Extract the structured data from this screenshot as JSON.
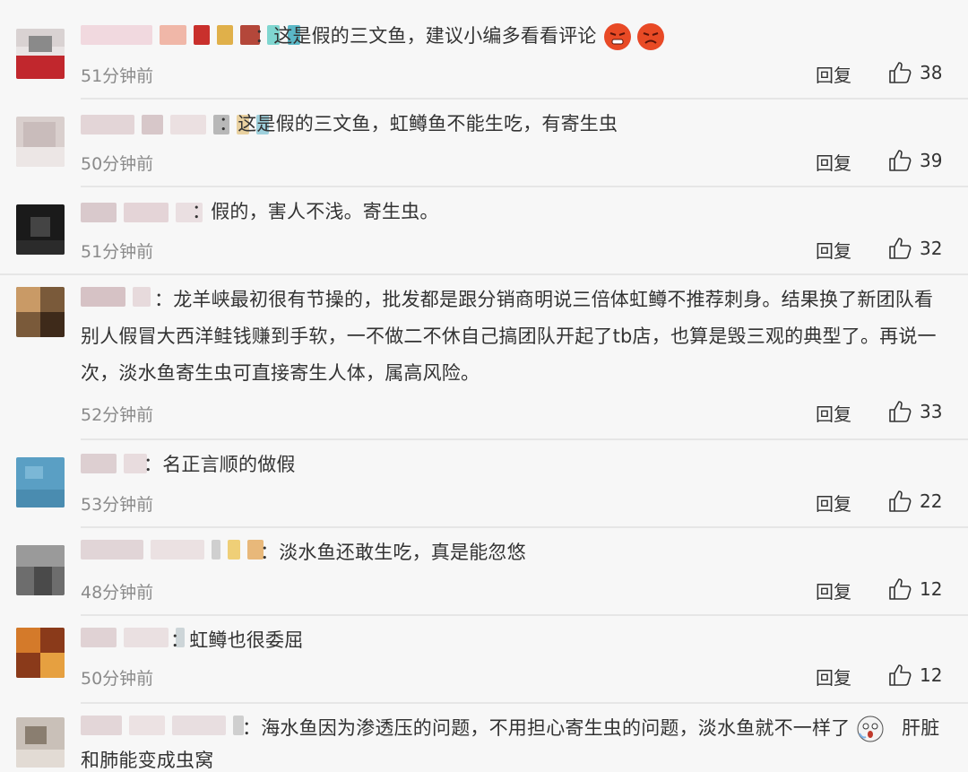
{
  "comments": [
    {
      "text": "：这是假的三文鱼，建议小编多看看评论",
      "time": "51分钟前",
      "reply": "回复",
      "likes": "38"
    },
    {
      "text": "：这是假的三文鱼，虹鳟鱼不能生吃，有寄生虫",
      "time": "50分钟前",
      "reply": "回复",
      "likes": "39"
    },
    {
      "text": "：假的，害人不浅。寄生虫。",
      "time": "51分钟前",
      "reply": "回复",
      "likes": "32"
    },
    {
      "text": "：龙羊峡最初很有节操的，批发都是跟分销商明说三倍体虹鳟不推荐刺身。结果换了新团队看别人假冒大西洋鲑钱赚到手软，一不做二不休自己搞团队开起了tb店，也算是毁三观的典型了。再说一次，淡水鱼寄生虫可直接寄生人体，属高风险。",
      "time": "52分钟前",
      "reply": "回复",
      "likes": "33"
    },
    {
      "text": "：名正言顺的做假",
      "time": "53分钟前",
      "reply": "回复",
      "likes": "22"
    },
    {
      "text": "：淡水鱼还敢生吃，真是能忽悠",
      "time": "48分钟前",
      "reply": "回复",
      "likes": "12"
    },
    {
      "text": "：虹鳟也很委屈",
      "time": "50分钟前",
      "reply": "回复",
      "likes": "12"
    },
    {
      "text": "：海水鱼因为渗透压的问题，不用担心寄生虫的问题，淡水鱼就不一样了",
      "text2": "肝脏和肺能变成虫窝",
      "time": "",
      "reply": "",
      "likes": ""
    }
  ],
  "colors": {
    "background": "#f7f7f7",
    "time": "#8a8a8a",
    "divider": "#e6e6e6"
  },
  "icons": {
    "like": "thumbs-up-icon",
    "emoji": "angry-face-icon",
    "emoji_scared": "scared-face-icon"
  }
}
